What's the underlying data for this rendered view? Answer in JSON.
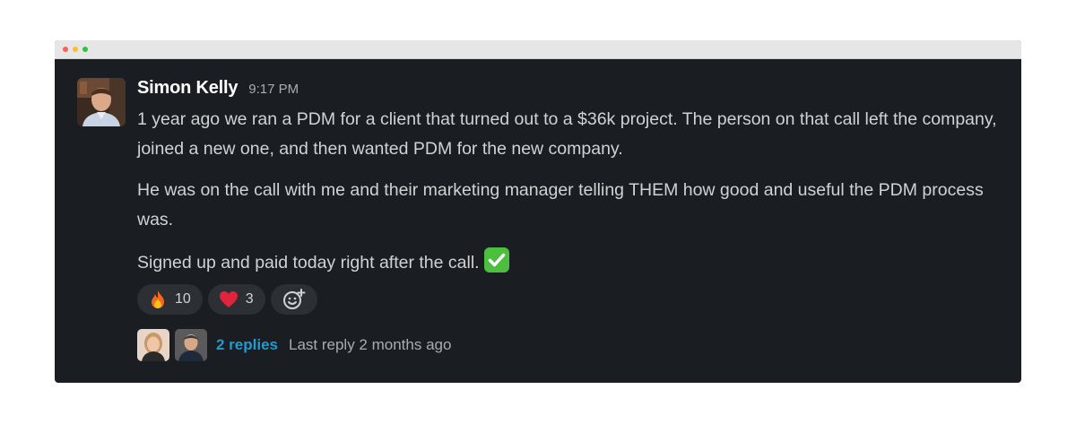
{
  "message": {
    "author": "Simon Kelly",
    "time": "9:17 PM",
    "paragraphs": [
      "1 year ago we ran a PDM for a client that turned out to a $36k project. The person on that call left the company, joined a new one, and then wanted PDM for the new company.",
      "He was on the call with me and their marketing manager telling THEM how good and useful the PDM process was.",
      "Signed up and paid today right after the call."
    ],
    "trailing_emoji": "white-check-mark"
  },
  "reactions": [
    {
      "emoji": "fire",
      "count": "10"
    },
    {
      "emoji": "red-heart",
      "count": "3"
    }
  ],
  "thread": {
    "replies_label": "2 replies",
    "last_reply": "Last reply 2 months ago"
  },
  "colors": {
    "background": "#1a1d21",
    "text": "#d1d2d3",
    "link": "#1d9bd1",
    "check_green": "#4dbf3f"
  }
}
